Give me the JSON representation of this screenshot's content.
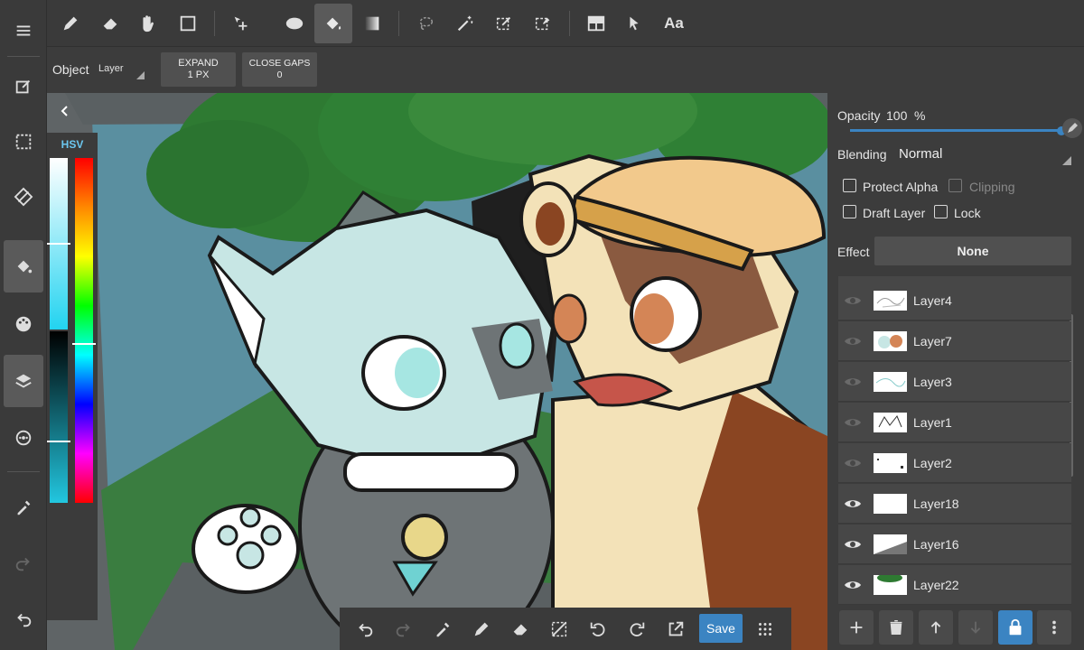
{
  "tool_options": {
    "object_label": "Object",
    "object_value": "Layer",
    "expand_label": "EXPAND",
    "expand_value": "1 PX",
    "close_gaps_label": "CLOSE GAPS",
    "close_gaps_value": "0"
  },
  "color_panel": {
    "mode_label": "HSV"
  },
  "layers_panel": {
    "opacity_label": "Opacity",
    "opacity_value": "100",
    "opacity_unit": "%",
    "opacity_fraction": 1.0,
    "blending_label": "Blending",
    "blending_value": "Normal",
    "protect_alpha_label": "Protect Alpha",
    "clipping_label": "Clipping",
    "draft_layer_label": "Draft Layer",
    "lock_label": "Lock",
    "effect_label": "Effect",
    "effect_value": "None",
    "layers": [
      {
        "name": "Layer4",
        "visible": false
      },
      {
        "name": "Layer7",
        "visible": false
      },
      {
        "name": "Layer3",
        "visible": false
      },
      {
        "name": "Layer1",
        "visible": false
      },
      {
        "name": "Layer2",
        "visible": false
      },
      {
        "name": "Layer18",
        "visible": true
      },
      {
        "name": "Layer16",
        "visible": true
      },
      {
        "name": "Layer22",
        "visible": true
      }
    ]
  },
  "top_toolbar": {
    "text_tool_label": "Aa"
  },
  "bottom_toolbar": {
    "save_label": "Save"
  },
  "colors": {
    "accent": "#3b84c2",
    "toolbar_bg": "#3a3a3a",
    "panel_bg": "#3c3c3c",
    "layer_row_bg": "#474747",
    "canvas_bg": "#5f6466"
  }
}
